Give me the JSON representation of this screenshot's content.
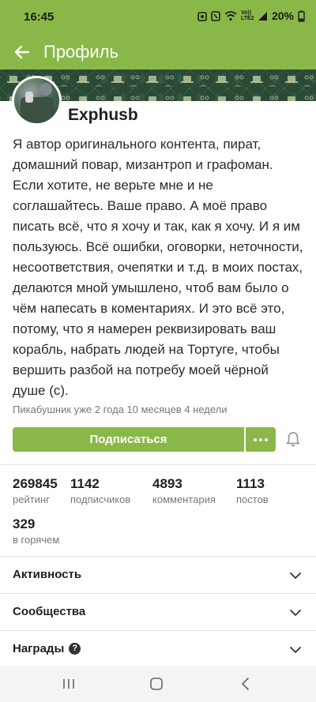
{
  "status_bar": {
    "time": "16:45",
    "battery": "20%",
    "network": "Vo)) LTE2",
    "icons": [
      "alarm-icon",
      "nfc-icon",
      "wifi-icon",
      "signal-icon",
      "battery-icon"
    ]
  },
  "app_bar": {
    "title": "Профиль",
    "back_icon": "arrow-left-icon"
  },
  "profile": {
    "username": "Exphusb",
    "bio": "Я автор оригинального контента, пират, домашний повар, мизантроп и графоман. Если хотите, не верьте мне и не соглашайтесь. Ваше право. А моё право писать всё, что я хочу и так, как я хочу. И я им пользуюсь. Всё ошибки, оговорки, неточности, несоответствия, очепятки и т.д. в моих постах, делаются мной умышлено, чтоб вам было о чём напесать в коментариях. И это всё это, потому, что я намерен реквизировать ваш корабль, набрать людей на Тортуге, чтобы вершить разбой на потребу моей чёрной душе (с).",
    "member_since": "Пикабушник уже 2 года 10 месяцев 4 недели"
  },
  "actions": {
    "subscribe_label": "Подписаться",
    "more_icon": "more-dots-icon",
    "bell_icon": "bell-icon"
  },
  "stats": [
    {
      "value": "269845",
      "label": "рейтинг"
    },
    {
      "value": "1142",
      "label": "подписчиков"
    },
    {
      "value": "4893",
      "label": "комментария"
    },
    {
      "value": "1113",
      "label": "постов"
    },
    {
      "value": "329",
      "label": "в горячем"
    }
  ],
  "sections": [
    {
      "label": "Активность"
    },
    {
      "label": "Сообщества"
    },
    {
      "label": "Награды"
    }
  ],
  "colors": {
    "brand": "#8ab848",
    "cover": "#2a4a36"
  }
}
